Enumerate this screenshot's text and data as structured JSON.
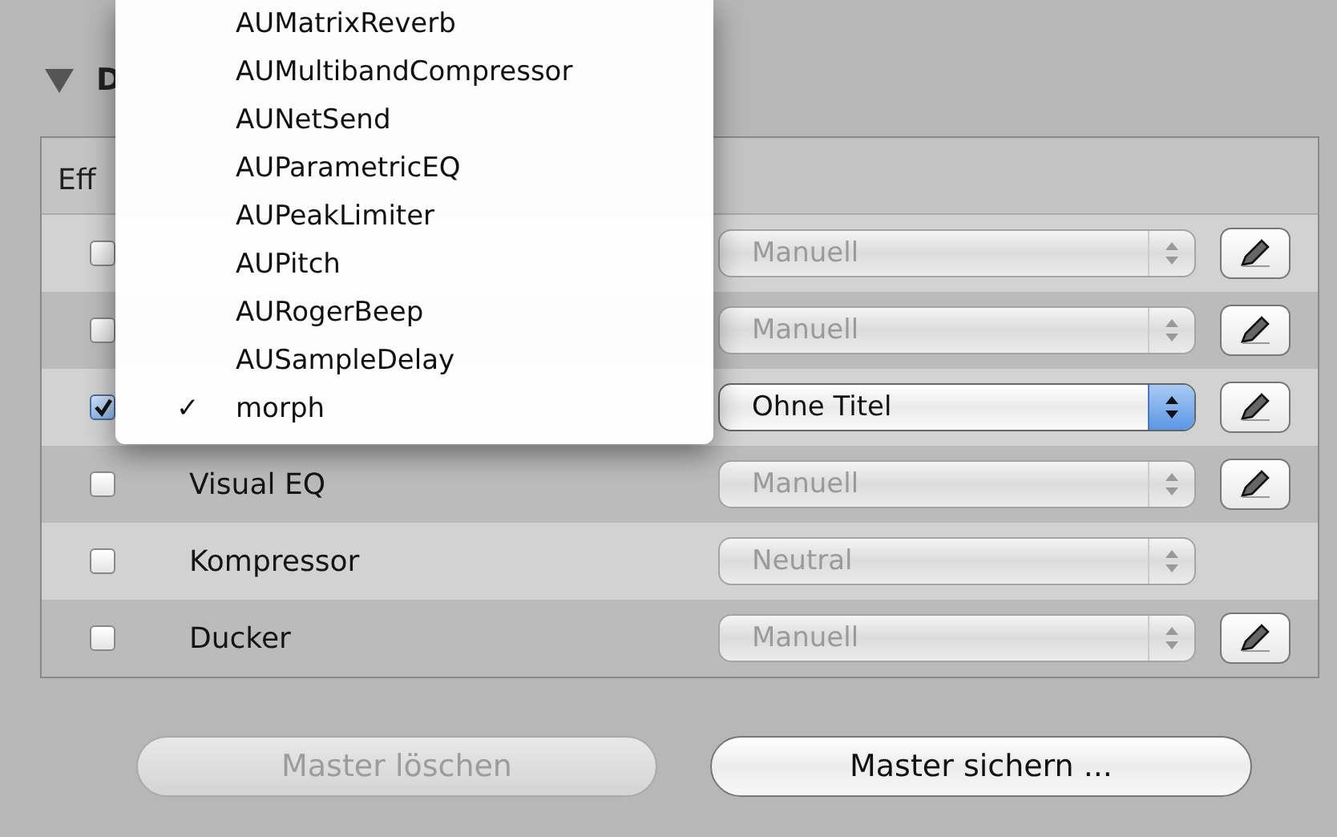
{
  "section": {
    "expanded": true,
    "title": "D"
  },
  "table": {
    "column_1": "Eff",
    "rows": [
      {
        "checked": false,
        "preset": "Manuell",
        "enabled": false,
        "editable": true
      },
      {
        "checked": false,
        "preset": "Manuell",
        "enabled": false,
        "editable": true
      },
      {
        "checked": true,
        "preset": "Ohne Titel",
        "enabled": true,
        "editable": true
      },
      {
        "checked": false,
        "name": "Visual EQ",
        "preset": "Manuell",
        "enabled": false,
        "editable": true
      },
      {
        "checked": false,
        "name": "Kompressor",
        "preset": "Neutral",
        "enabled": false,
        "editable": false
      },
      {
        "checked": false,
        "name": "Ducker",
        "preset": "Manuell",
        "enabled": false,
        "editable": true
      }
    ]
  },
  "menu": {
    "check_mark": "✓",
    "items": [
      {
        "label": "AUMatrixReverb",
        "selected": false
      },
      {
        "label": "AUMultibandCompressor",
        "selected": false
      },
      {
        "label": "AUNetSend",
        "selected": false
      },
      {
        "label": "AUParametricEQ",
        "selected": false
      },
      {
        "label": "AUPeakLimiter",
        "selected": false
      },
      {
        "label": "AUPitch",
        "selected": false
      },
      {
        "label": "AURogerBeep",
        "selected": false
      },
      {
        "label": "AUSampleDelay",
        "selected": false
      },
      {
        "label": "morph",
        "selected": true
      }
    ]
  },
  "buttons": [
    {
      "label": "Master löschen",
      "disabled": true
    },
    {
      "label": "Master sichern ...",
      "disabled": false
    }
  ]
}
